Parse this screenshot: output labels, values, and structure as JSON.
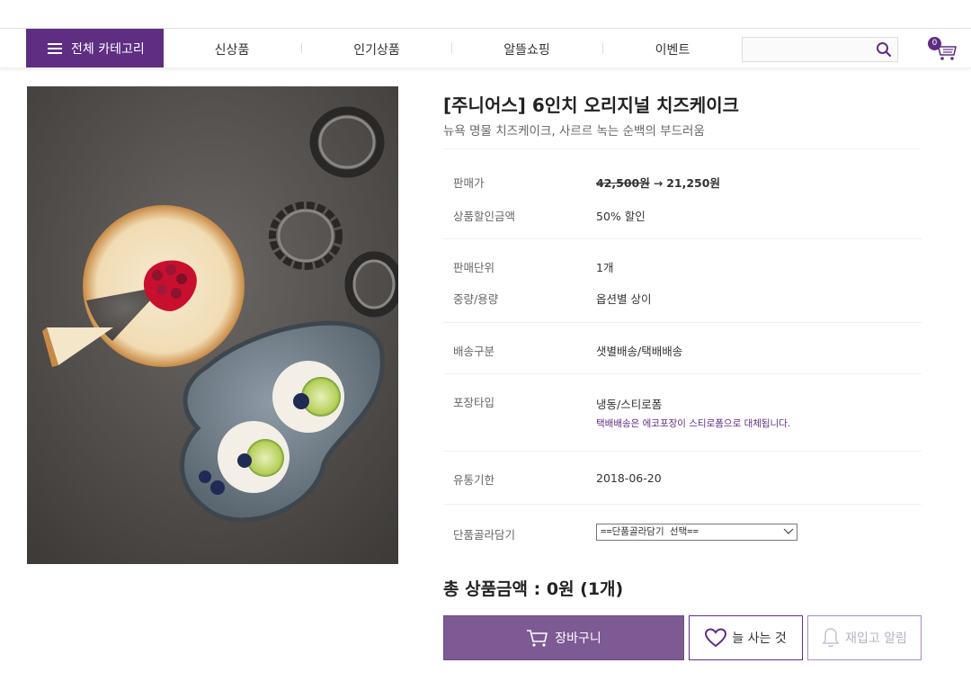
{
  "nav": {
    "category_label": "전체 카테고리",
    "menu": [
      "신상품",
      "인기상품",
      "알뜰쇼핑",
      "이벤트"
    ],
    "search_placeholder": "",
    "cart_count": "0"
  },
  "product": {
    "title": "[주니어스] 6인치 오리지널 치즈케이크",
    "subtitle": "뉴욕 명물 치즈케이크, 사르르 녹는 순백의 부드러움",
    "price_label": "판매가",
    "original_price": "42,500원",
    "arrow": "→",
    "sale_price": "21,250원",
    "discount_label": "상품할인금액",
    "discount_value": "50% 할인",
    "unit_label": "판매단위",
    "unit_value": "1개",
    "weight_label": "중량/용량",
    "weight_value": "옵션별 상이",
    "delivery_label": "배송구분",
    "delivery_value": "샛별배송/택배배송",
    "package_label": "포장타입",
    "package_value": "냉동/스티로폼",
    "package_note": "택배배송은 에코포장이 스티로폼으로 대체됩니다.",
    "expiry_label": "유통기한",
    "expiry_value": "2018-06-20",
    "option_label": "단품골라담기",
    "option_selected": "==단품골라담기 선택==",
    "total": "총 상품금액 : 0원 (1개)"
  },
  "buttons": {
    "cart": "장바구니",
    "wish": "늘 사는 것",
    "restock": "재입고 알림"
  },
  "colors": {
    "brand": "#5f2d82",
    "cart_button": "#7d5a94"
  }
}
